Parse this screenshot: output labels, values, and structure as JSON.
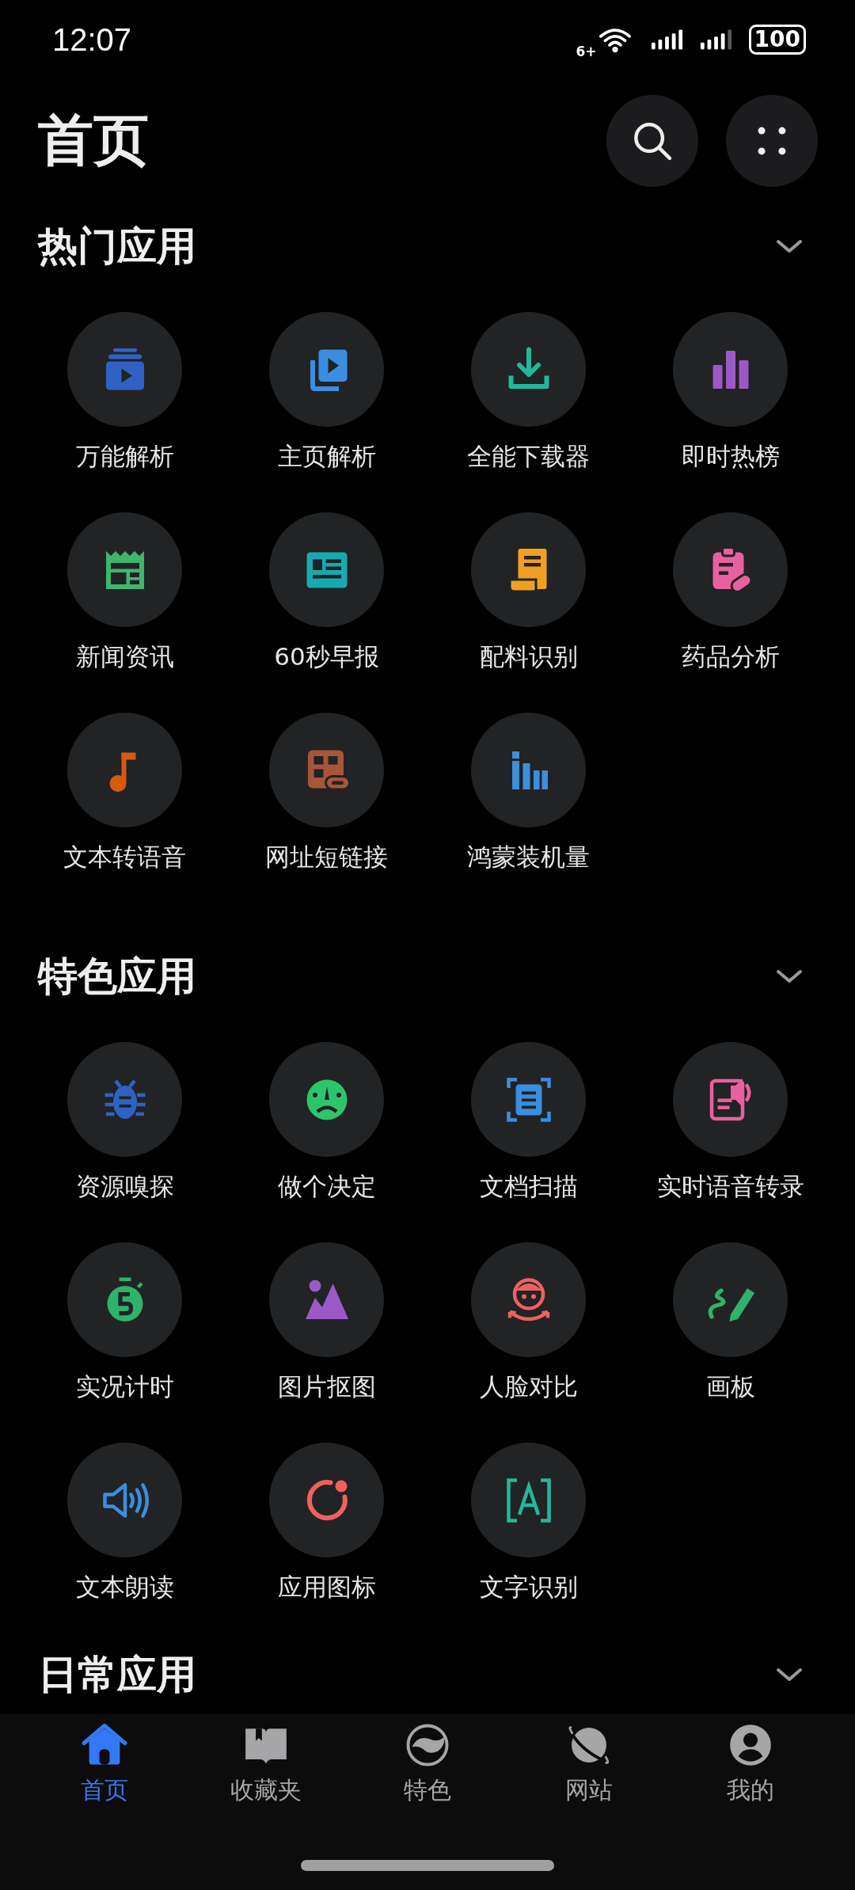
{
  "status_bar": {
    "time": "12:07",
    "network_badge": "6+",
    "battery": "100"
  },
  "header": {
    "title": "首页"
  },
  "sections": [
    {
      "title": "热门应用",
      "expanded": true,
      "apps": [
        {
          "label": "万能解析"
        },
        {
          "label": "主页解析"
        },
        {
          "label": "全能下载器"
        },
        {
          "label": "即时热榜"
        },
        {
          "label": "新闻资讯"
        },
        {
          "label": "60秒早报"
        },
        {
          "label": "配料识别"
        },
        {
          "label": "药品分析"
        },
        {
          "label": "文本转语音"
        },
        {
          "label": "网址短链接"
        },
        {
          "label": "鸿蒙装机量"
        }
      ]
    },
    {
      "title": "特色应用",
      "expanded": true,
      "apps": [
        {
          "label": "资源嗅探"
        },
        {
          "label": "做个决定"
        },
        {
          "label": "文档扫描"
        },
        {
          "label": "实时语音转录"
        },
        {
          "label": "实况计时"
        },
        {
          "label": "图片抠图"
        },
        {
          "label": "人脸对比"
        },
        {
          "label": "画板"
        },
        {
          "label": "文本朗读"
        },
        {
          "label": "应用图标"
        },
        {
          "label": "文字识别"
        }
      ]
    },
    {
      "title": "日常应用",
      "expanded": true
    }
  ],
  "bottom_nav": [
    {
      "label": "首页",
      "selected": true
    },
    {
      "label": "收藏夹",
      "selected": false
    },
    {
      "label": "特色",
      "selected": false
    },
    {
      "label": "网站",
      "selected": false
    },
    {
      "label": "我的",
      "selected": false
    }
  ]
}
